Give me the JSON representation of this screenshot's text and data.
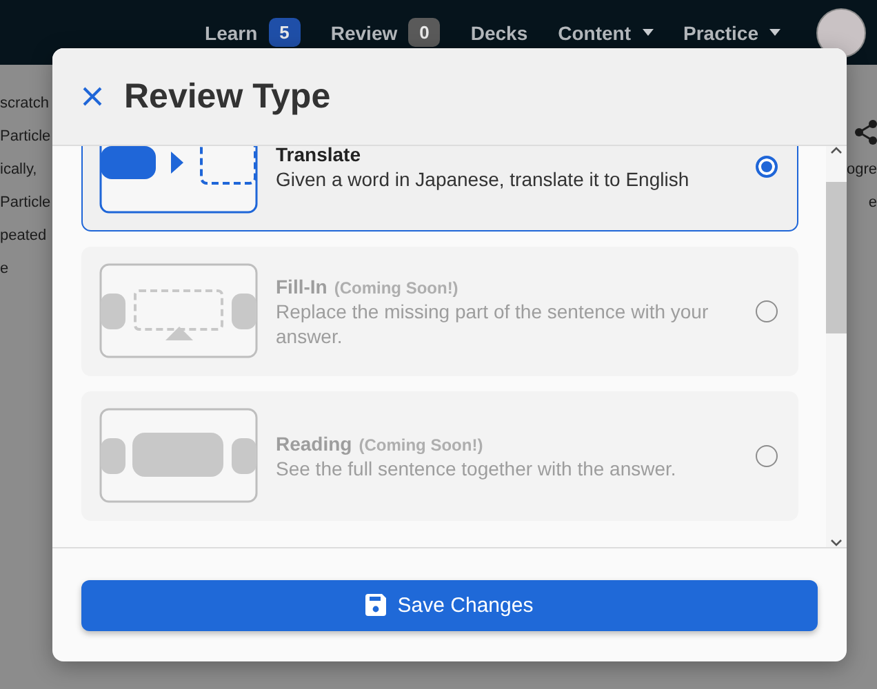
{
  "nav": {
    "items": [
      {
        "label": "Learn",
        "kind": "badge",
        "badge": "5",
        "color": "#1f4fa8"
      },
      {
        "label": "Review",
        "kind": "badge",
        "badge": "0",
        "color": "#5a5a5a"
      },
      {
        "label": "Decks",
        "kind": "plain"
      },
      {
        "label": "Content",
        "kind": "dropdown"
      },
      {
        "label": "Practice",
        "kind": "dropdown"
      }
    ]
  },
  "background": {
    "left_texts": [
      "scratch",
      "Particle",
      "ically,",
      "Particle",
      "peated",
      "e"
    ],
    "right_texts": [
      "ogre",
      "e"
    ]
  },
  "modal": {
    "title": "Review Type",
    "options": [
      {
        "kind": "translate",
        "title": "Translate",
        "description": "Given a word in Japanese, translate it to English",
        "selected": true,
        "disabled": false
      },
      {
        "kind": "fill-in",
        "title": "Fill-In",
        "note": "(Coming Soon!)",
        "description": "Replace the missing part of the sentence with your answer.",
        "selected": false,
        "disabled": true
      },
      {
        "kind": "reading",
        "title": "Reading",
        "note": "(Coming Soon!)",
        "description": "See the full sentence together with the answer.",
        "selected": false,
        "disabled": true
      }
    ],
    "save_button": "Save Changes"
  }
}
